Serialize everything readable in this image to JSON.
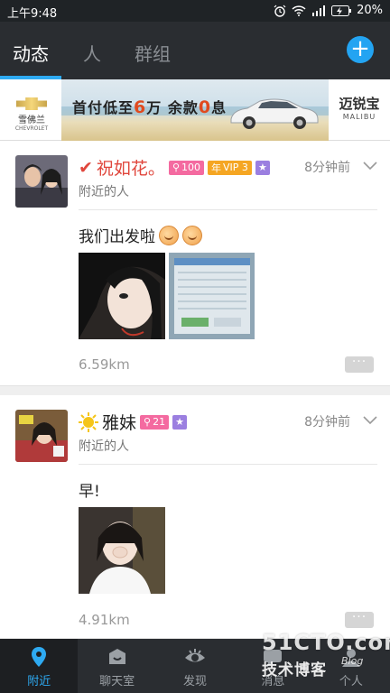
{
  "status_bar": {
    "time": "上午9:48",
    "battery": "20%"
  },
  "tabs": [
    {
      "label": "动态",
      "active": true
    },
    {
      "label": "人",
      "active": false
    },
    {
      "label": "群组",
      "active": false
    }
  ],
  "add_button": "+",
  "banner": {
    "brand_cn": "雪佛兰",
    "brand_en": "CHEVROLET",
    "slogan_1": "首付低至",
    "slogan_num1": "6",
    "slogan_2": "万 余款",
    "slogan_num2": "0",
    "slogan_3": "息",
    "model_cn": "迈锐宝",
    "model_en": "MALIBU"
  },
  "posts": [
    {
      "name_prefix": "✔",
      "name": "祝如花。",
      "name_color": "#e0463c",
      "badges": [
        {
          "text": "100",
          "kind": "pink"
        },
        {
          "text": "VIP 3",
          "prefix": "年",
          "kind": "orange"
        },
        {
          "text": "★",
          "kind": "purple"
        }
      ],
      "time": "8分钟前",
      "location": "附近的人",
      "content": "我们出发啦",
      "emoji_count": 2,
      "distance": "6.59km",
      "more": "···"
    },
    {
      "name_prefix": "",
      "name": "雅妹",
      "name_color": "#222222",
      "badges": [
        {
          "text": "21",
          "kind": "pink"
        },
        {
          "text": "★",
          "kind": "purple"
        }
      ],
      "time": "8分钟前",
      "location": "附近的人",
      "content": "早!",
      "distance": "4.91km",
      "more": "···"
    }
  ],
  "bottom_nav": [
    {
      "label": "附近",
      "icon": "location-pin-icon",
      "active": true
    },
    {
      "label": "聊天室",
      "icon": "chat-room-icon",
      "active": false
    },
    {
      "label": "发现",
      "icon": "eye-icon",
      "active": false
    },
    {
      "label": "消息",
      "icon": "message-icon",
      "active": false
    },
    {
      "label": "个人",
      "icon": "person-icon",
      "active": false
    }
  ],
  "watermark": {
    "big": "51CTO.com",
    "cn": "技术博客",
    "blog": "Blog"
  },
  "colors": {
    "accent": "#2eaaf2",
    "topbar": "#2a2d31",
    "badge_pink": "#f46aa0",
    "badge_orange": "#f5a623",
    "badge_purple": "#9b7fe0"
  }
}
